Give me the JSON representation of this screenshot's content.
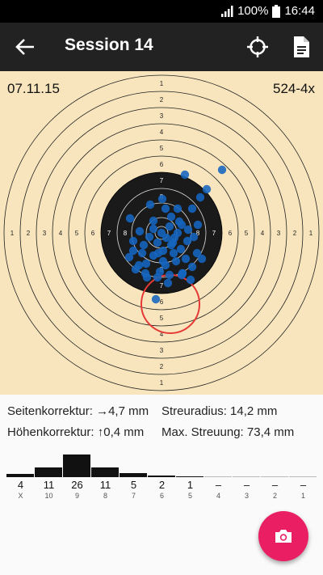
{
  "status": {
    "battery": "100%",
    "time": "16:44"
  },
  "toolbar": {
    "title": "Session 14"
  },
  "target": {
    "date": "07.11.15",
    "score": "524-4x",
    "colors": {
      "paper": "#f8e5bd",
      "black": "#1a1a1a",
      "shot": "#1565c0",
      "group_circle": "#e53935"
    }
  },
  "stats": {
    "lateral_label": "Seitenkorrektur:",
    "lateral_value": "→4,7 mm",
    "vertical_label": "Höhenkorrektur:",
    "vertical_value": "↑0,4 mm",
    "spread_radius_label": "Streuradius:",
    "spread_radius_value": "14,2 mm",
    "max_spread_label": "Max. Streuung:",
    "max_spread_value": "73,4 mm"
  },
  "chart_data": {
    "type": "bar",
    "categories": [
      "X",
      "10",
      "9",
      "8",
      "7",
      "6",
      "5",
      "4",
      "3",
      "2",
      "1"
    ],
    "counts": [
      "4",
      "11",
      "26",
      "11",
      "5",
      "2",
      "1",
      "–",
      "–",
      "–",
      "–"
    ],
    "values": [
      4,
      11,
      26,
      11,
      5,
      2,
      1,
      0,
      0,
      0,
      0
    ]
  }
}
